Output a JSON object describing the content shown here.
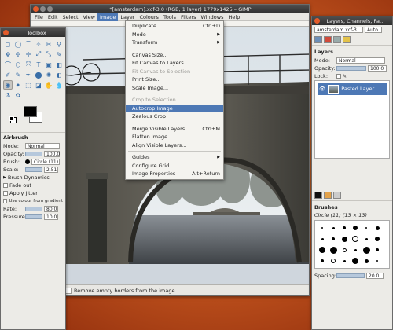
{
  "main_window": {
    "title": "*[amsterdam].xcf-3.0 (RGB, 1 layer) 1779x1425 – GIMP",
    "menu": [
      "File",
      "Edit",
      "Select",
      "View",
      "Image",
      "Layer",
      "Colours",
      "Tools",
      "Filters",
      "Windows",
      "Help"
    ],
    "active_menu": "Image",
    "status": {
      "unit": "px",
      "zoom": "50 %",
      "message": "Remove empty borders from the image"
    }
  },
  "image_menu": {
    "items": [
      {
        "label": "Duplicate",
        "shortcut": "Ctrl+D",
        "state": "normal"
      },
      {
        "label": "Mode",
        "submenu": true,
        "state": "normal"
      },
      {
        "label": "Transform",
        "submenu": true,
        "state": "normal"
      },
      {
        "separator": true
      },
      {
        "label": "Canvas Size...",
        "state": "normal"
      },
      {
        "label": "Fit Canvas to Layers",
        "state": "normal"
      },
      {
        "label": "Fit Canvas to Selection",
        "state": "disabled"
      },
      {
        "label": "Print Size...",
        "state": "normal"
      },
      {
        "label": "Scale Image...",
        "state": "normal"
      },
      {
        "separator": true
      },
      {
        "label": "Crop to Selection",
        "state": "disabled"
      },
      {
        "label": "Autocrop Image",
        "state": "highlighted"
      },
      {
        "label": "Zealous Crop",
        "state": "normal"
      },
      {
        "separator": true
      },
      {
        "label": "Merge Visible Layers...",
        "shortcut": "Ctrl+M",
        "state": "normal"
      },
      {
        "label": "Flatten Image",
        "state": "normal"
      },
      {
        "label": "Align Visible Layers...",
        "state": "normal"
      },
      {
        "separator": true
      },
      {
        "label": "Guides",
        "submenu": true,
        "state": "normal"
      },
      {
        "label": "Configure Grid...",
        "state": "normal"
      },
      {
        "label": "Image Properties",
        "shortcut": "Alt+Return",
        "state": "normal"
      }
    ]
  },
  "toolbox": {
    "title": "Toolbox",
    "options_title": "Airbrush",
    "mode_label": "Mode:",
    "mode_value": "Normal",
    "opacity_label": "Opacity:",
    "opacity_value": "100.0",
    "brush_label": "Brush:",
    "brush_value": "Circle (11)",
    "scale_label": "Scale:",
    "scale_value": "2.51",
    "brush_dynamics": "Brush Dynamics",
    "fade_out": "Fade out",
    "apply_jitter": "Apply Jitter",
    "use_colour": "Use colour from gradient",
    "rate_label": "Rate:",
    "rate_value": "80.0",
    "pressure_label": "Pressure:",
    "pressure_value": "10.0",
    "tool_icons": [
      "◻",
      "◯",
      "⌒",
      "✧",
      "✂",
      "⚲",
      "✥",
      "✢",
      "✛",
      "⤢",
      "⤡",
      "✎",
      "⌒",
      "⬡",
      "⤧",
      "T",
      "▣",
      "◧",
      "✐",
      "✎",
      "✒",
      "⬤",
      "✺",
      "◐",
      "◉",
      "✦",
      "⬚",
      "◪",
      "✋",
      "💧",
      "⚗",
      "✿"
    ]
  },
  "dock": {
    "title": "Layers, Channels, Pa…",
    "image_selector": "amsterdam.xcf-3",
    "auto_label": "Auto",
    "layers_title": "Layers",
    "mode_label": "Mode:",
    "mode_value": "Normal",
    "opacity_label": "Opacity:",
    "opacity_value": "100.0",
    "lock_label": "Lock:",
    "layer_name": "Pasted Layer",
    "brushes_title": "Brushes",
    "brush_name": "Circle (11) (13 × 13)",
    "spacing_label": "Spacing:",
    "spacing_value": "20.0"
  },
  "colors": {
    "desktop": "#c5561f",
    "highlight": "#4d78b5",
    "foreground": "#000000",
    "background": "#ffffff"
  }
}
